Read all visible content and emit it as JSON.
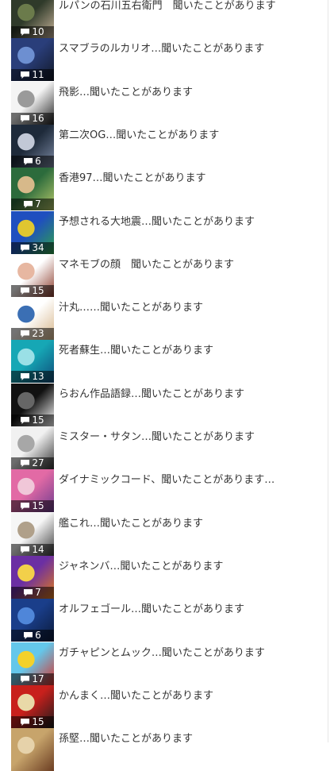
{
  "articles": [
    {
      "title": "ルパンの石川五右衛門　聞いたことがあります",
      "comments": "10",
      "palette": [
        "#2f3a2a",
        "#c8b49a",
        "#6b7b4b"
      ]
    },
    {
      "title": "スマブラのルカリオ…聞いたことがあります",
      "comments": "11",
      "palette": [
        "#2a3e7a",
        "#111827",
        "#6d8fd1"
      ]
    },
    {
      "title": "飛影…聞いたことがあります",
      "comments": "16",
      "palette": [
        "#f4f4f4",
        "#222222",
        "#9a9a9a"
      ]
    },
    {
      "title": "第二次OG…聞いたことがあります",
      "comments": "6",
      "palette": [
        "#1e2a3a",
        "#7c8aa4",
        "#c2c8d6"
      ]
    },
    {
      "title": "香港97…聞いたことがあります",
      "comments": "7",
      "palette": [
        "#2c6b3c",
        "#b6c86a",
        "#d7b98a"
      ]
    },
    {
      "title": "予想される大地震…聞いたことがあります",
      "comments": "34",
      "palette": [
        "#1f4fbf",
        "#2fa34a",
        "#e0c630"
      ]
    },
    {
      "title": "マネモブの顔　聞いたことがあります",
      "comments": "15",
      "palette": [
        "#ffffff",
        "#8a3a2a",
        "#e7b7a1"
      ]
    },
    {
      "title": "汁丸……聞いたことがあります",
      "comments": "23",
      "palette": [
        "#ffffff",
        "#d6b58a",
        "#3b6fb4"
      ]
    },
    {
      "title": "死者蘇生…聞いたことがあります",
      "comments": "13",
      "palette": [
        "#16a7b5",
        "#0f4c7a",
        "#9ae0e6"
      ]
    },
    {
      "title": "らおん作品語録…聞いたことがあります",
      "comments": "15",
      "palette": [
        "#111111",
        "#ffffff",
        "#666666"
      ]
    },
    {
      "title": "ミスター・サタン…聞いたことがあります",
      "comments": "27",
      "palette": [
        "#f1f1f1",
        "#333333",
        "#a7a7a7"
      ]
    },
    {
      "title": "ダイナミックコード、聞いたことがあります…",
      "comments": "15",
      "palette": [
        "#e26aa5",
        "#6f3c8f",
        "#f0c7d8"
      ]
    },
    {
      "title": "艦これ…聞いたことがあります",
      "comments": "14",
      "palette": [
        "#f6f6f6",
        "#3b3b3b",
        "#b0a08a"
      ]
    },
    {
      "title": "ジャネンバ…聞いたことがあります",
      "comments": "7",
      "palette": [
        "#6b2fa3",
        "#e07a1a",
        "#f2d04a"
      ]
    },
    {
      "title": "オルフェゴール…聞いたことがあります",
      "comments": "6",
      "palette": [
        "#1a3e8a",
        "#0b1a3a",
        "#4f86d9"
      ]
    },
    {
      "title": "ガチャピンとムック…聞いたことがあります",
      "comments": "17",
      "palette": [
        "#64c7ea",
        "#d8322b",
        "#f3d12a"
      ]
    },
    {
      "title": "かんまく…聞いたことがあります",
      "comments": "15",
      "palette": [
        "#c8201c",
        "#1b1b1b",
        "#e9d9a8"
      ]
    },
    {
      "title": "孫堅…聞いたことがあります",
      "comments": "",
      "palette": [
        "#c7a46b",
        "#6b3d22",
        "#e6d2aa"
      ]
    }
  ]
}
